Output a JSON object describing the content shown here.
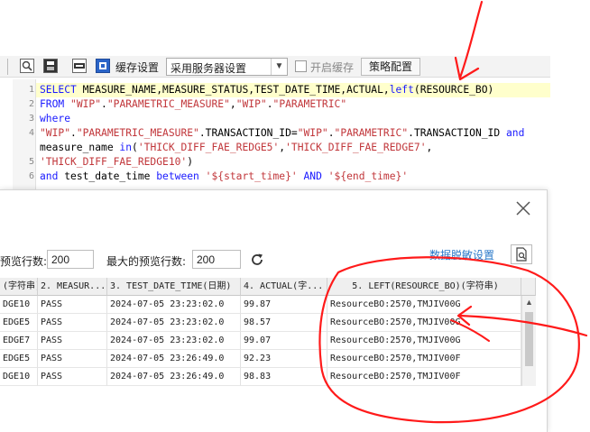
{
  "toolbar": {
    "cache_settings_label": "缓存设置",
    "cache_mode_value": "采用服务器设置",
    "enable_cache_label": "开启缓存",
    "strategy_button_label": "策略配置"
  },
  "editor": {
    "line_numbers": [
      "1",
      "2",
      "3",
      "4",
      "",
      "5",
      "6"
    ],
    "lines": [
      [
        [
          "kw",
          "SELECT "
        ],
        [
          "plain",
          "MEASURE_NAME,MEASURE_STATUS,TEST_DATE_TIME,ACTUAL,"
        ],
        [
          "kw",
          "left"
        ],
        [
          "plain",
          "(RESOURCE_BO)"
        ]
      ],
      [
        [
          "kw",
          "FROM "
        ],
        [
          "str",
          "\"WIP\""
        ],
        [
          "plain",
          "."
        ],
        [
          "str",
          "\"PARAMETRIC_MEASURE\""
        ],
        [
          "plain",
          ","
        ],
        [
          "str",
          "\"WIP\""
        ],
        [
          "plain",
          "."
        ],
        [
          "str",
          "\"PARAMETRIC\""
        ]
      ],
      [
        [
          "kw",
          "where"
        ]
      ],
      [
        [
          "str",
          "\"WIP\""
        ],
        [
          "plain",
          "."
        ],
        [
          "str",
          "\"PARAMETRIC_MEASURE\""
        ],
        [
          "plain",
          ".TRANSACTION_ID="
        ],
        [
          "str",
          "\"WIP\""
        ],
        [
          "plain",
          "."
        ],
        [
          "str",
          "\"PARAMETRIC\""
        ],
        [
          "plain",
          ".TRANSACTION_ID "
        ],
        [
          "kw",
          "and"
        ]
      ],
      [
        [
          "plain",
          "measure_name "
        ],
        [
          "kw",
          "in"
        ],
        [
          "plain",
          "("
        ],
        [
          "str",
          "'THICK_DIFF_FAE_REDGE5'"
        ],
        [
          "plain",
          ","
        ],
        [
          "str",
          "'THICK_DIFF_FAE_REDGE7'"
        ],
        [
          "plain",
          ","
        ]
      ],
      [
        [
          "str",
          "'THICK_DIFF_FAE_REDGE10'"
        ],
        [
          "plain",
          ")"
        ]
      ],
      [
        [
          "kw",
          "and "
        ],
        [
          "plain",
          "test_date_time "
        ],
        [
          "kw",
          "between "
        ],
        [
          "str",
          "'${start_time}'"
        ],
        [
          "kw",
          " AND "
        ],
        [
          "str",
          "'${end_time}'"
        ]
      ]
    ]
  },
  "dialog": {
    "preview_rows_label": "预览行数:",
    "preview_rows_value": "200",
    "max_preview_rows_label": "最大的预览行数:",
    "max_preview_rows_value": "200",
    "desensitization_link": "数据脱敏设置"
  },
  "table": {
    "headers": [
      "(字符串)",
      "2. MEASUR...",
      "3. TEST_DATE_TIME(日期)",
      "4. ACTUAL(字...",
      "5. LEFT(RESOURCE_BO)(字符串)"
    ],
    "rows": [
      [
        "DGE10",
        "PASS",
        "2024-07-05 23:23:02.0",
        "99.87",
        "ResourceBO:2570,TMJIV00G"
      ],
      [
        "EDGE5",
        "PASS",
        "2024-07-05 23:23:02.0",
        "98.57",
        "ResourceBO:2570,TMJIV00G"
      ],
      [
        "EDGE7",
        "PASS",
        "2024-07-05 23:23:02.0",
        "99.07",
        "ResourceBO:2570,TMJIV00G"
      ],
      [
        "EDGE5",
        "PASS",
        "2024-07-05 23:26:49.0",
        "92.23",
        "ResourceBO:2570,TMJIV00F"
      ],
      [
        "DGE10",
        "PASS",
        "2024-07-05 23:26:49.0",
        "98.83",
        "ResourceBO:2570,TMJIV00F"
      ]
    ]
  },
  "colors": {
    "keyword": "#1a1aff",
    "string": "#c1363a",
    "link": "#2a79c9",
    "annotation": "#ff1a1a",
    "highlight_line": "#ffffcc"
  }
}
